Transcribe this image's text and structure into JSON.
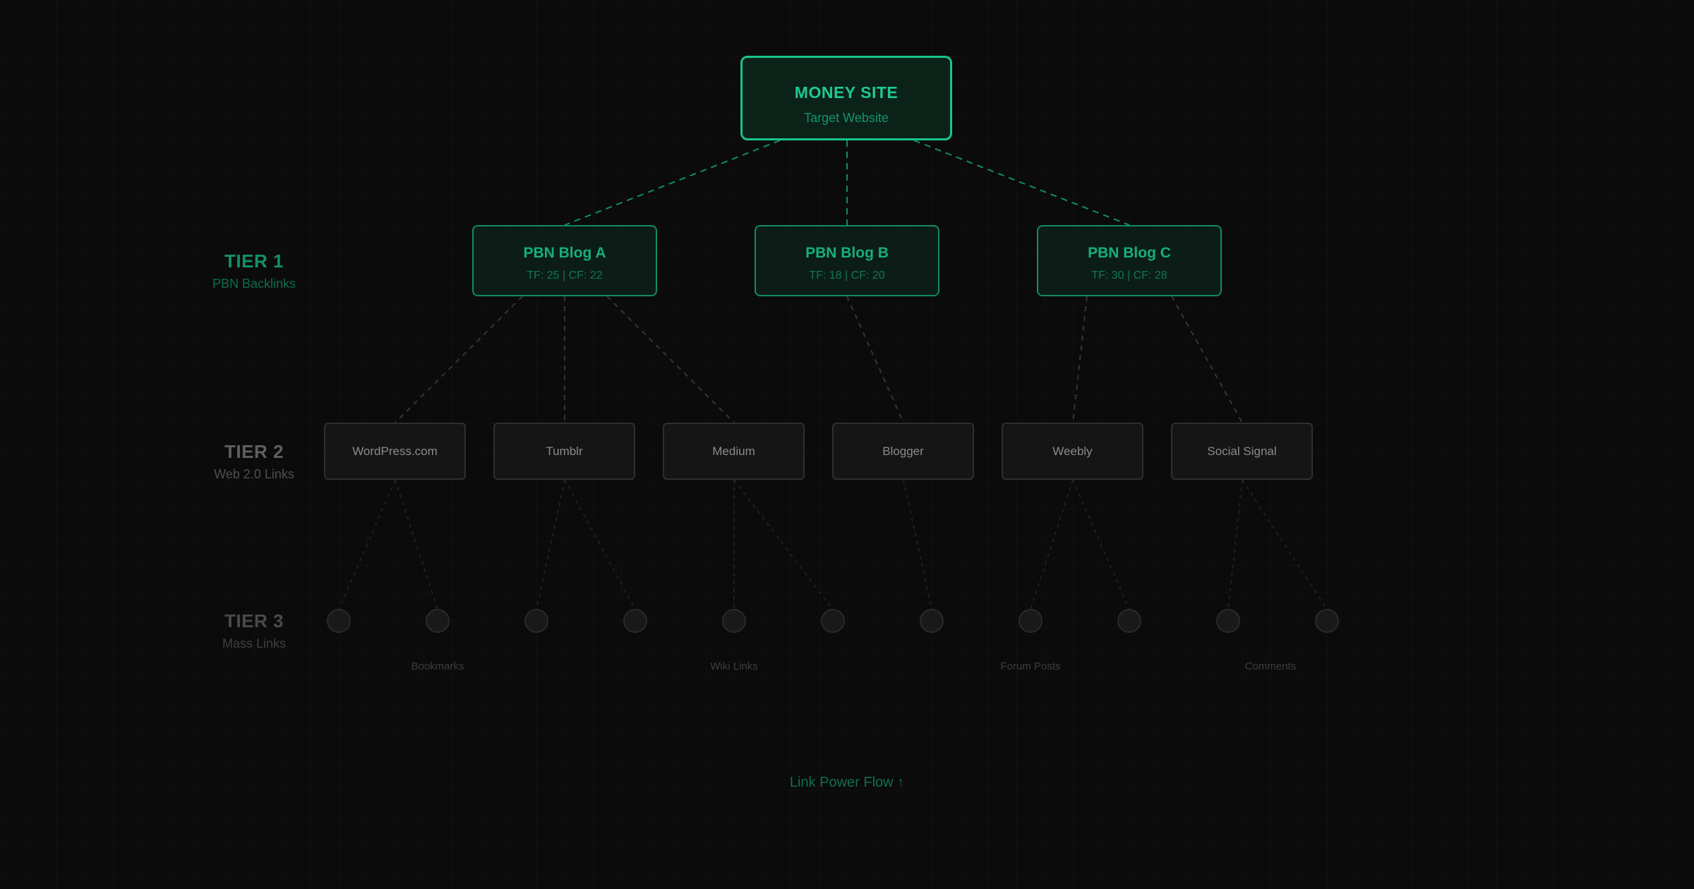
{
  "tiers": {
    "tier1": {
      "name": "TIER 1",
      "sub": "PBN Backlinks"
    },
    "tier2": {
      "name": "TIER 2",
      "sub": "Web 2.0 Links"
    },
    "tier3": {
      "name": "TIER 3",
      "sub": "Mass Links"
    }
  },
  "money_site": {
    "title": "MONEY SITE",
    "sub": "Target Website"
  },
  "pbn_blogs": [
    {
      "title": "PBN Blog A",
      "metrics": "TF: 25 | CF: 22"
    },
    {
      "title": "PBN Blog B",
      "metrics": "TF: 18 | CF: 20"
    },
    {
      "title": "PBN Blog C",
      "metrics": "TF: 30 | CF: 28"
    }
  ],
  "web2": [
    "WordPress.com",
    "Tumblr",
    "Medium",
    "Blogger",
    "Weebly",
    "Social Signal"
  ],
  "mass_labels": [
    "Bookmarks",
    "Wiki Links",
    "Forum Posts",
    "Comments"
  ],
  "flow_label": "Link Power Flow ↑",
  "colors": {
    "background": "#0b0b0b",
    "accent": "#19c48c",
    "tier1_green": "#11916a",
    "tier2_gray": "#5f5f5f",
    "tier3_gray": "#4a4a4a"
  }
}
